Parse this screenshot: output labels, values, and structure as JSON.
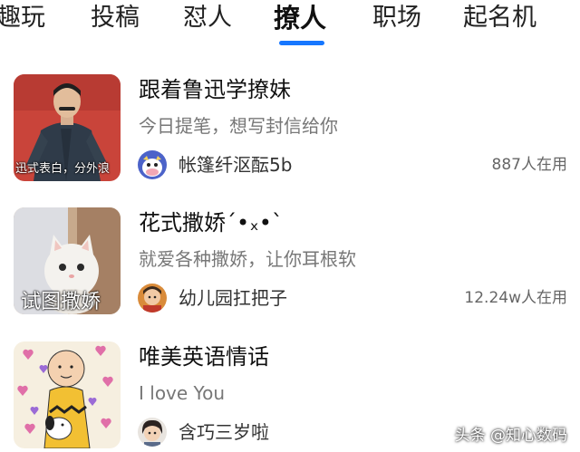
{
  "tabs": [
    {
      "label": "趣玩"
    },
    {
      "label": "投稿"
    },
    {
      "label": "怼人"
    },
    {
      "label": "撩人",
      "active": true
    },
    {
      "label": "职场"
    },
    {
      "label": "起名机"
    }
  ],
  "accent_color": "#1677ff",
  "items": [
    {
      "thumb_caption": "迅式表白，分外浪",
      "title": "跟着鲁迅学撩妹",
      "subtitle": "今日提笔，想写封信给你",
      "author": "帐篷纤沤酝5b",
      "online": "887人在用"
    },
    {
      "thumb_caption": "试图撒娇",
      "title": "花式撒娇´•ₓ•`",
      "subtitle": "就爱各种撒娇，让你耳根软",
      "author": "幼儿园扛把子",
      "online": "12.24w人在用"
    },
    {
      "thumb_caption": "",
      "title": "唯美英语情话",
      "subtitle": "I love You",
      "author": "含巧三岁啦",
      "online": ""
    }
  ],
  "watermark": "头条 @知心数码"
}
